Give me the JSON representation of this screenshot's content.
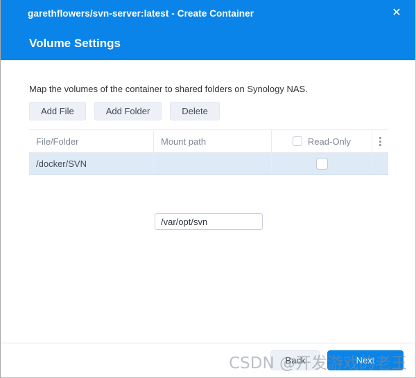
{
  "window": {
    "title": "garethflowers/svn-server:latest - Create Container",
    "close_icon": "close-icon",
    "accent_color": "#0a84e8",
    "row_highlight_color": "#dfeaf7"
  },
  "header": {
    "section_title": "Volume Settings"
  },
  "main": {
    "description": "Map the volumes of the container to shared folders on Synology NAS.",
    "toolbar": {
      "add_file_label": "Add File",
      "add_folder_label": "Add Folder",
      "delete_label": "Delete"
    },
    "table": {
      "columns": [
        {
          "label": "File/Folder"
        },
        {
          "label": "Mount path"
        },
        {
          "label": "Read-Only"
        }
      ],
      "header_checkbox_checked": false,
      "menu_icon": "vertical-dots-icon",
      "rows": [
        {
          "file_folder": "/docker/SVN",
          "mount_path": "/var/opt/svn",
          "mount_path_placeholder": "Mount path",
          "read_only": false,
          "selected": true
        }
      ]
    }
  },
  "footer": {
    "back_label": "Back",
    "next_label": "Next"
  },
  "watermark": {
    "text": "CSDN @开发游戏的老王"
  }
}
